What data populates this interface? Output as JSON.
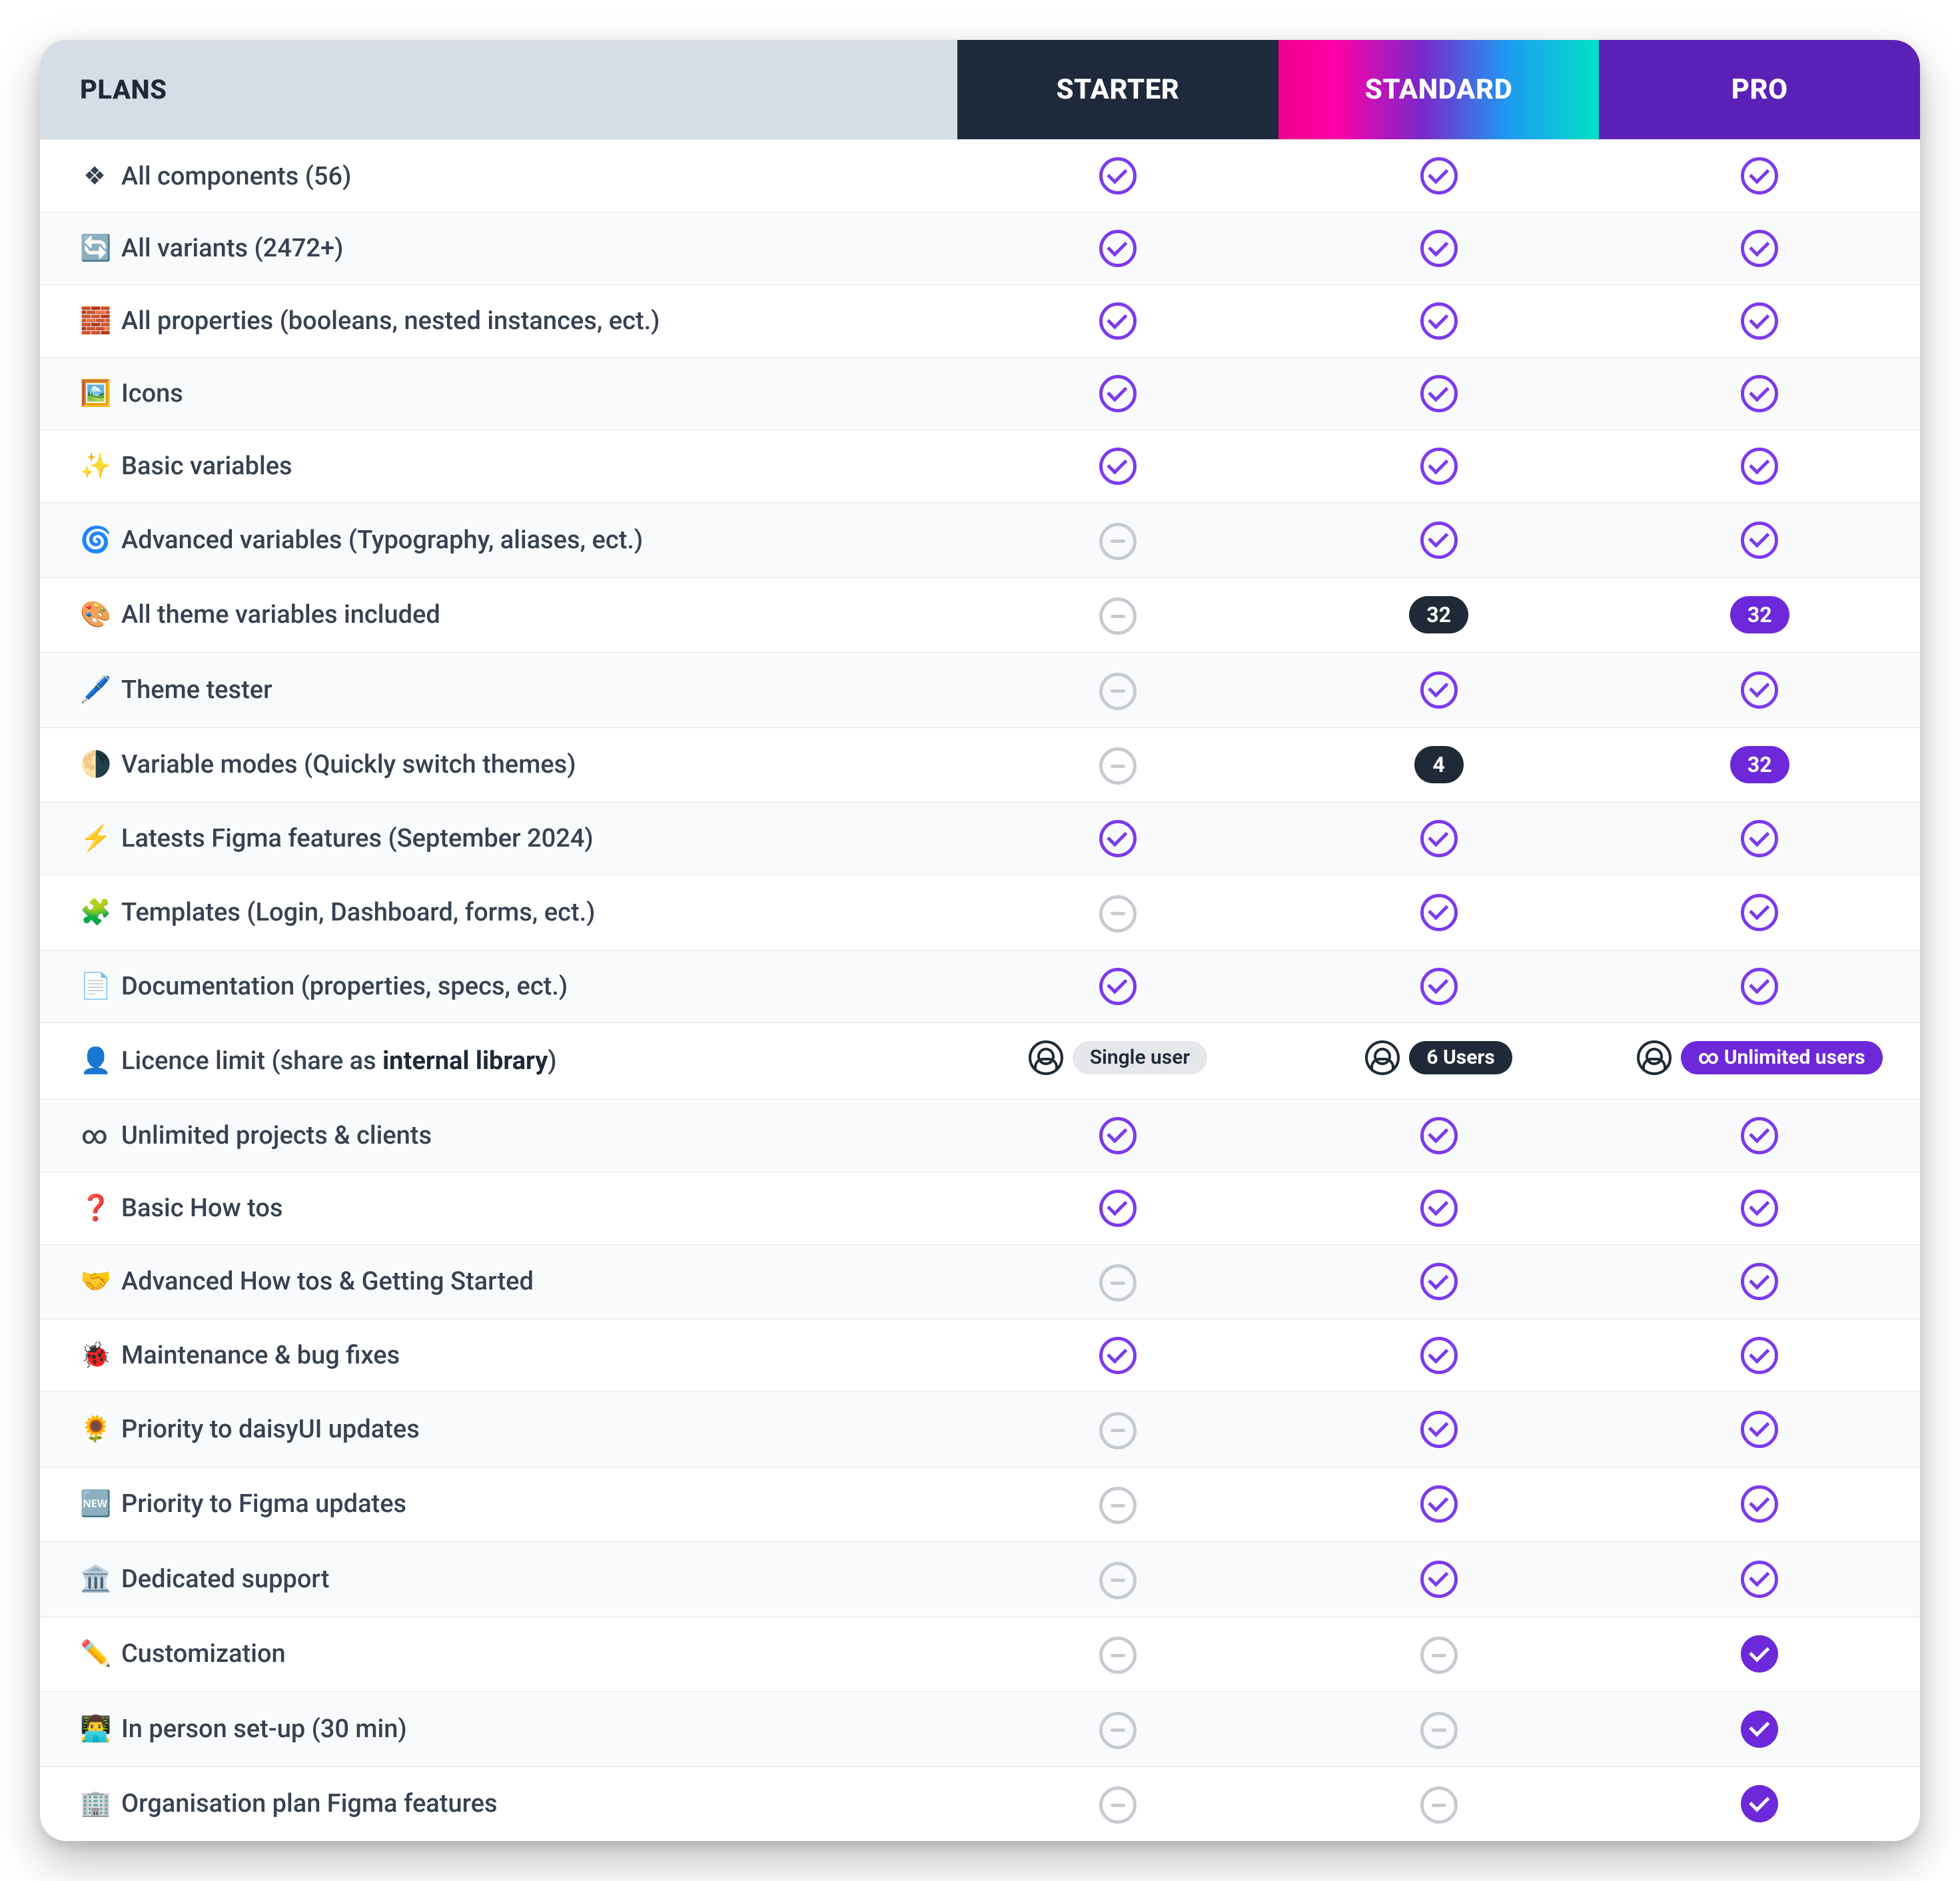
{
  "header": {
    "plans_label": "PLANS",
    "cols": [
      "STARTER",
      "STANDARD",
      "PRO"
    ]
  },
  "cell_types_legend": {
    "check": "feature included (purple outline check)",
    "minus": "feature not included (grey outline minus)",
    "check_fill": "feature included (solid purple check)",
    "badge_dark": "numeric pill, dark background",
    "badge_purple": "numeric pill, purple background",
    "licence_light": "licence pill, light grey",
    "licence_dark": "licence pill, dark",
    "licence_purple": "licence pill, purple"
  },
  "rows": [
    {
      "emoji": "❖",
      "label": "All components (56)",
      "cells": [
        {
          "t": "check"
        },
        {
          "t": "check"
        },
        {
          "t": "check"
        }
      ]
    },
    {
      "emoji": "🔄",
      "label": "All variants (2472+)",
      "cells": [
        {
          "t": "check"
        },
        {
          "t": "check"
        },
        {
          "t": "check"
        }
      ]
    },
    {
      "emoji": "🧱",
      "label": "All properties (booleans, nested instances, ect.)",
      "cells": [
        {
          "t": "check"
        },
        {
          "t": "check"
        },
        {
          "t": "check"
        }
      ]
    },
    {
      "emoji": "🖼️",
      "label": "Icons",
      "cells": [
        {
          "t": "check"
        },
        {
          "t": "check"
        },
        {
          "t": "check"
        }
      ]
    },
    {
      "emoji": "✨",
      "label": "Basic variables",
      "cells": [
        {
          "t": "check"
        },
        {
          "t": "check"
        },
        {
          "t": "check"
        }
      ]
    },
    {
      "emoji": "🌀",
      "label": "Advanced variables (Typography, aliases, ect.)",
      "cells": [
        {
          "t": "minus"
        },
        {
          "t": "check"
        },
        {
          "t": "check"
        }
      ]
    },
    {
      "emoji": "🎨",
      "label": "All theme variables included",
      "cells": [
        {
          "t": "minus"
        },
        {
          "t": "badge_dark",
          "v": "32"
        },
        {
          "t": "badge_purple",
          "v": "32"
        }
      ]
    },
    {
      "emoji": "🖊️",
      "label": "Theme tester",
      "cells": [
        {
          "t": "minus"
        },
        {
          "t": "check"
        },
        {
          "t": "check"
        }
      ]
    },
    {
      "emoji": "🌗",
      "label": "Variable modes (Quickly switch themes)",
      "cells": [
        {
          "t": "minus"
        },
        {
          "t": "badge_dark",
          "v": "4"
        },
        {
          "t": "badge_purple",
          "v": "32"
        }
      ]
    },
    {
      "emoji": "⚡",
      "label": "Latests Figma features (September 2024)",
      "cells": [
        {
          "t": "check"
        },
        {
          "t": "check"
        },
        {
          "t": "check"
        }
      ]
    },
    {
      "emoji": "🧩",
      "label": "Templates (Login, Dashboard, forms, ect.)",
      "cells": [
        {
          "t": "minus"
        },
        {
          "t": "check"
        },
        {
          "t": "check"
        }
      ]
    },
    {
      "emoji": "📄",
      "label": "Documentation (properties, specs, ect.)",
      "cells": [
        {
          "t": "check"
        },
        {
          "t": "check"
        },
        {
          "t": "check"
        }
      ]
    },
    {
      "emoji": "👤",
      "label": "Licence limit (share as ",
      "strong": "internal library",
      "label_tail": ")",
      "cells": [
        {
          "t": "licence_light",
          "v": "Single user"
        },
        {
          "t": "licence_dark",
          "v": "6 Users"
        },
        {
          "t": "licence_purple",
          "v": "∞ Unlimited users"
        }
      ]
    },
    {
      "emoji": "∞",
      "label": "Unlimited projects & clients",
      "cells": [
        {
          "t": "check"
        },
        {
          "t": "check"
        },
        {
          "t": "check"
        }
      ]
    },
    {
      "emoji": "❓",
      "label": "Basic How tos",
      "cells": [
        {
          "t": "check"
        },
        {
          "t": "check"
        },
        {
          "t": "check"
        }
      ]
    },
    {
      "emoji": "🤝",
      "label": "Advanced How tos & Getting Started",
      "cells": [
        {
          "t": "minus"
        },
        {
          "t": "check"
        },
        {
          "t": "check"
        }
      ]
    },
    {
      "emoji": "🐞",
      "label": "Maintenance & bug fixes",
      "cells": [
        {
          "t": "check"
        },
        {
          "t": "check"
        },
        {
          "t": "check"
        }
      ]
    },
    {
      "emoji": "🌻",
      "label": "Priority to daisyUI updates",
      "cells": [
        {
          "t": "minus"
        },
        {
          "t": "check"
        },
        {
          "t": "check"
        }
      ]
    },
    {
      "emoji": "🆕",
      "label": "Priority to Figma updates",
      "cells": [
        {
          "t": "minus"
        },
        {
          "t": "check"
        },
        {
          "t": "check"
        }
      ]
    },
    {
      "emoji": "🏛️",
      "label": "Dedicated support",
      "cells": [
        {
          "t": "minus"
        },
        {
          "t": "check"
        },
        {
          "t": "check"
        }
      ]
    },
    {
      "emoji": "✏️",
      "label": "Customization",
      "cells": [
        {
          "t": "minus"
        },
        {
          "t": "minus"
        },
        {
          "t": "check_fill"
        }
      ]
    },
    {
      "emoji": "👨‍💻",
      "label": "In person set-up (30 min)",
      "cells": [
        {
          "t": "minus"
        },
        {
          "t": "minus"
        },
        {
          "t": "check_fill"
        }
      ]
    },
    {
      "emoji": "🏢",
      "label": "Organisation plan Figma features",
      "cells": [
        {
          "t": "minus"
        },
        {
          "t": "minus"
        },
        {
          "t": "check_fill"
        }
      ]
    }
  ]
}
